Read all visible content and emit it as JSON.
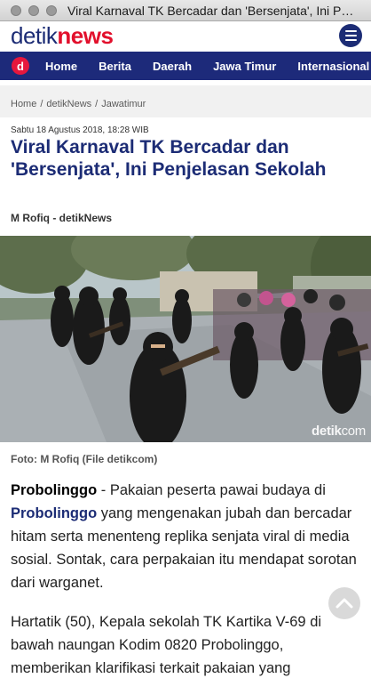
{
  "window": {
    "title": "Viral Karnaval TK Bercadar dan 'Bersenjata', Ini Penjelasan Sekolah"
  },
  "header": {
    "logo_part1": "detik",
    "logo_part2": "news"
  },
  "nav": {
    "logo_letter": "d",
    "items": [
      "Home",
      "Berita",
      "Daerah",
      "Jawa Timur",
      "Internasional"
    ]
  },
  "breadcrumb": [
    "Home",
    "detikNews",
    "Jawatimur"
  ],
  "article": {
    "date": "Sabtu 18 Agustus 2018, 18:28 WIB",
    "title": "Viral Karnaval TK Bercadar dan 'Bersenjata', Ini Penjelasan Sekolah",
    "author": "M Rofiq - detikNews",
    "photo_watermark_1": "detik",
    "photo_watermark_2": "com",
    "caption": "Foto: M Rofiq (File detikcom)",
    "p1_lead": "Probolinggo",
    "p1_dash": " - Pakaian peserta pawai budaya di ",
    "p1_link": "Probolinggo",
    "p1_rest": " yang mengenakan jubah dan bercadar hitam serta menenteng replika senjata viral di media sosial. Sontak, cara perpakaian itu mendapat sorotan dari warganet.",
    "p2": "Hartatik (50), Kepala sekolah TK Kartika V-69 di bawah naungan Kodim 0820 Probolinggo, memberikan klarifikasi terkait pakaian yang"
  },
  "colors": {
    "brand_blue": "#1c2c75",
    "brand_red": "#e2102c",
    "nav_bg": "#1d2a7a"
  },
  "icons": {
    "menu": "hamburger-menu-icon",
    "scroll_top": "chevron-up-icon"
  }
}
